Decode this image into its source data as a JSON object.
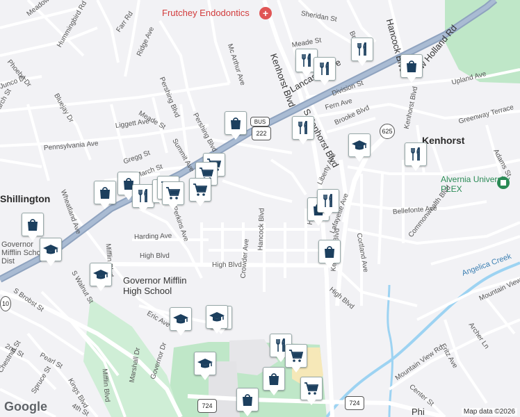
{
  "map": {
    "towns": {
      "shillington": "Shillington",
      "kenhorst": "Kenhorst"
    },
    "pois": {
      "frutchey": "Frutchey Endodontics",
      "alvernia": "Alvernia University PLEX",
      "gm_high": "Governor Mifflin High School",
      "gm_school_dist": "Governor Mifflin School Dist"
    },
    "streets": {
      "meadowlark": "Meadowlark Rd",
      "farr": "Farr Rd",
      "hummingbird": "Hummingbird Rd",
      "ridge": "Ridge Ave",
      "phoebe": "Phoebe Dr",
      "junco": "Junco Dr",
      "bluejay": "Bluejay Dr",
      "march_st": "March St",
      "liggett": "Liggett Ave",
      "meade1": "Meade St",
      "meade2": "Meade St",
      "pershing1": "Pershing Blvd",
      "pershing2": "Pershing Blvd",
      "summit": "Summit Ave",
      "mcarthur": "Mc Arthur Ave",
      "pennsylvania": "Pennsylvania Ave",
      "gregg": "Gregg St",
      "march2": "March St",
      "wheatland": "Wheatland Ave",
      "lancaster": "Lancaster Ave",
      "kenhorst_blvd": "Kenhorst Blvd",
      "s_kenhorst": "S Kenhorst Blvd",
      "sheridan": "Sheridan St",
      "brookline": "Brookline",
      "hancock_top": "Hancock Blvd",
      "division": "Division St",
      "fern": "Fern Ave",
      "brooke": "Brooke Blvd",
      "new_holland": "New Holland Rd",
      "upland": "Upland Ave",
      "greenway": "Greenway Terrace",
      "adams": "Adams St",
      "liberty": "Liberty Ave",
      "lafayette": "Lafayette Ave",
      "holland": "Holland",
      "bellefonte": "Bellefonte Ave",
      "cortland": "Cortland Ave",
      "commonwealth": "Commonwealth Blvd",
      "kenhorst_blvd2": "Kenhorst Blvd",
      "hancock": "Hancock Blvd",
      "crowder": "Crowder Ave",
      "harding": "Harding Ave",
      "high1": "High Blvd",
      "high2": "High Blvd",
      "high3": "High Blvd",
      "mifflin": "Mifflin Blvd",
      "mifflin2": "Mifflin Blvd",
      "s_walnut": "S Walnut St",
      "s_brobst": "S Brobst St",
      "eric": "Eric Ave",
      "second": "2nd St",
      "chestnut": "Chestnut St",
      "pearl": "Pearl St",
      "kings": "Kings Blvd",
      "spruce": "Spruce St",
      "fourth": "4th St",
      "marshall": "Marshall Dr",
      "governor": "Governor Dr",
      "angelica": "Angelica Creek",
      "mountain_view_rd": "Mountain View Rd",
      "mountain_view": "Mountain View",
      "archer": "Archer Ln",
      "fritz": "Fritz Ave",
      "center": "Center St",
      "phil": "Phi",
      "perkins": "Perkins Ave",
      "kenhorst_ave": "Kenhorst Blvd"
    },
    "shields": {
      "bus": "BUS",
      "r222": "222",
      "r625": "625",
      "r724a": "724",
      "r724b": "724",
      "r724c": "724",
      "r10": "10"
    },
    "footer": {
      "google": "Google",
      "attribution": "Map data ©2026"
    },
    "colors": {
      "background": "#f2f2f5",
      "road": "#ffffff",
      "highway": "#8fa3bf",
      "park": "#bfe7c8",
      "creek": "#9dd3f2",
      "campus": "#eaeaea",
      "plaza": "#f6e8b8",
      "marker": "#1c3f5e"
    }
  }
}
